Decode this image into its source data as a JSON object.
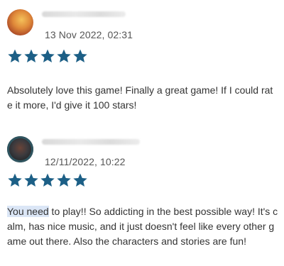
{
  "reviews": [
    {
      "avatar_icon": "user-avatar-sunset",
      "timestamp": "13 Nov 2022, 02:31",
      "rating": 5,
      "rating_max": 5,
      "text": "Absolutely love this game! Finally a great game! If I could rate it more, I'd give it 100 stars!"
    },
    {
      "avatar_icon": "user-avatar-dark",
      "timestamp": "12/11/2022, 10:22",
      "rating": 5,
      "rating_max": 5,
      "text_highlighted": "You need",
      "text_rest": " to play!! So addicting in the best possible way! It's calm, has nice music, and it just doesn't feel like every other game out there. Also the characters and stories are fun!"
    }
  ],
  "colors": {
    "star": "#1c5f86",
    "text": "#333333",
    "timestamp": "#555555",
    "selection_highlight": "#dbe6f6"
  }
}
